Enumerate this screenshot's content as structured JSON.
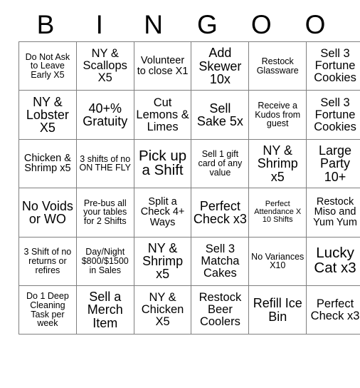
{
  "card": {
    "title_letters": [
      "B",
      "I",
      "N",
      "G",
      "O",
      "O"
    ],
    "columns": 6,
    "rows": 7,
    "grid_line_color": "#7f7f7f",
    "text_color": "#000000",
    "background_color": "#ffffff",
    "cells": [
      [
        {
          "text": "Do Not Ask to Leave Early X5",
          "size": "fs-sm"
        },
        {
          "text": "NY & Scallops X5",
          "size": "fs-lg"
        },
        {
          "text": "Volunteer to close X1",
          "size": "fs-md"
        },
        {
          "text": "Add Skewer 10x",
          "size": "fs-xl"
        },
        {
          "text": "Restock Glassware",
          "size": "fs-sm"
        },
        {
          "text": "Sell 3 Fortune Cookies",
          "size": "fs-lg"
        }
      ],
      [
        {
          "text": "NY & Lobster X5",
          "size": "fs-xl"
        },
        {
          "text": "40+% Gratuity",
          "size": "fs-xl"
        },
        {
          "text": "Cut Lemons & Limes",
          "size": "fs-lg"
        },
        {
          "text": "Sell Sake 5x",
          "size": "fs-xl"
        },
        {
          "text": "Receive a Kudos from guest",
          "size": "fs-sm"
        },
        {
          "text": "Sell 3 Fortune Cookies",
          "size": "fs-lg"
        }
      ],
      [
        {
          "text": "Chicken & Shrimp x5",
          "size": "fs-md"
        },
        {
          "text": "3 shifts of no ON THE FLY",
          "size": "fs-sm"
        },
        {
          "text": "Pick up a Shift",
          "size": "fs-xxl"
        },
        {
          "text": "Sell 1 gift card of any value",
          "size": "fs-sm"
        },
        {
          "text": "NY & Shrimp x5",
          "size": "fs-xl"
        },
        {
          "text": "Large Party 10+",
          "size": "fs-xl"
        }
      ],
      [
        {
          "text": "No Voids or WO",
          "size": "fs-xl"
        },
        {
          "text": "Pre-bus all your tables for 2 Shifts",
          "size": "fs-sm"
        },
        {
          "text": "Split a Check 4+ Ways",
          "size": "fs-md"
        },
        {
          "text": "Perfect Check x3",
          "size": "fs-xl"
        },
        {
          "text": "Perfect Attendance X 10 Shifts",
          "size": "fs-xs"
        },
        {
          "text": "Restock Miso and Yum Yum",
          "size": "fs-md"
        }
      ],
      [
        {
          "text": "3 Shift of no returns or refires",
          "size": "fs-sm"
        },
        {
          "text": "Day/Night $800/$1500 in Sales",
          "size": "fs-sm"
        },
        {
          "text": "NY & Shrimp x5",
          "size": "fs-xl"
        },
        {
          "text": "Sell 3 Matcha Cakes",
          "size": "fs-lg"
        },
        {
          "text": "No Variances X10",
          "size": "fs-sm"
        },
        {
          "text": "Lucky Cat x3",
          "size": "fs-xxl"
        }
      ],
      [
        {
          "text": "Do 1 Deep Cleaning Task per week",
          "size": "fs-sm"
        },
        {
          "text": "Sell a Merch Item",
          "size": "fs-xl"
        },
        {
          "text": "NY & Chicken X5",
          "size": "fs-lg"
        },
        {
          "text": "Restock Beer Coolers",
          "size": "fs-lg"
        },
        {
          "text": "Refill Ice Bin",
          "size": "fs-xl"
        },
        {
          "text": "Perfect Check x3",
          "size": "fs-lg"
        }
      ]
    ]
  }
}
